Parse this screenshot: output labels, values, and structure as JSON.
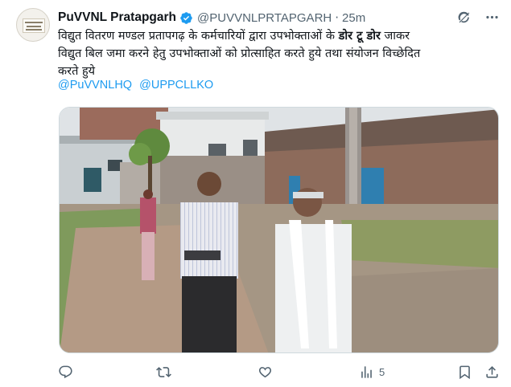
{
  "tweet": {
    "author_name": "PuVVNL Pratapgarh",
    "handle": "@PUVVNLPRTAPGARH",
    "separator": "·",
    "time": "25m",
    "text_line1_a": "विद्युत वितरण मण्डल प्रतापगढ़ के कर्मचारियों द्वारा उपभोक्ताओं के ",
    "text_line1_bold": "डोर टू डोर",
    "text_line1_b": " जाकर",
    "text_line2": "विद्युत बिल जमा करने हेतु उपभोक्ताओं को प्रोत्साहित करते हुये तथा संयोजन विच्छेदित",
    "text_line3": "करते हुये",
    "mentions": [
      "@PuVVNLHQ",
      "@UPPCLLKO"
    ]
  },
  "actions": {
    "reply_icon": "reply-icon",
    "retweet_icon": "retweet-icon",
    "like_icon": "like-icon",
    "views_icon": "views-icon",
    "views_count": "5",
    "bookmark_icon": "bookmark-icon",
    "share_icon": "share-icon"
  },
  "header_icons": [
    "grok-icon",
    "more-icon"
  ],
  "colors": {
    "link": "#1d9bf0",
    "muted": "#536471",
    "verified": "#1d9bf0"
  }
}
